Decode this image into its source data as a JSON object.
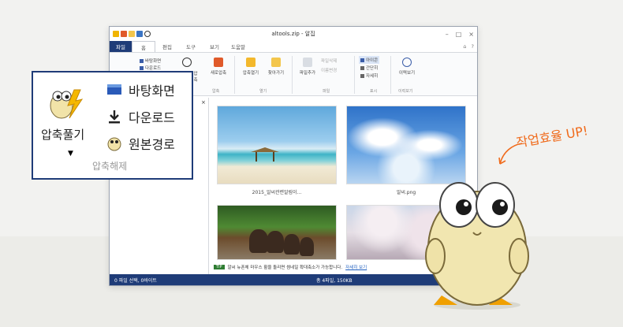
{
  "window": {
    "title": "altools.zip - 알집",
    "menu": {
      "file": "파일",
      "tabs": [
        "홈",
        "편집",
        "도구",
        "보기",
        "도움말"
      ]
    },
    "ribbon": {
      "partial_first": "압축",
      "small_items": [
        "바탕화면",
        "다운로드"
      ],
      "buttons": [
        "새로압축",
        "압축열기",
        "찾아가기",
        "파일추가",
        "이력보기"
      ],
      "view_options": [
        "아이콘",
        "간단히",
        "자세히"
      ],
      "disabled_items": [
        "파일삭제",
        "이름변경"
      ],
      "groups": [
        "압축",
        "열기",
        "파일",
        "표시",
        "이력보기"
      ]
    },
    "close_pane": "×",
    "thumbnails": [
      {
        "caption": "2015_알씨관련알림이..."
      },
      {
        "caption": "알씨.png"
      },
      {
        "caption": ""
      },
      {
        "caption": ""
      }
    ],
    "tip": {
      "tag": "TIP",
      "text": "알씨 뉴폰체 마우스 휠을 돌리면 썸네일 확대축소가 가능합니다.",
      "link": "자세히 보기"
    },
    "status": {
      "left": "0 파일 선택, 0바이트",
      "right": "총 4파일, 150KB"
    }
  },
  "zoom": {
    "extract_label": "압축풀기",
    "caret": "▼",
    "options": [
      "바탕화면",
      "다운로드",
      "원본경로"
    ],
    "group_label": "압축해제"
  },
  "slogan": "작업효율 UP!",
  "colors": {
    "accent": "#1f3c78",
    "slogan": "#f06b1c"
  }
}
